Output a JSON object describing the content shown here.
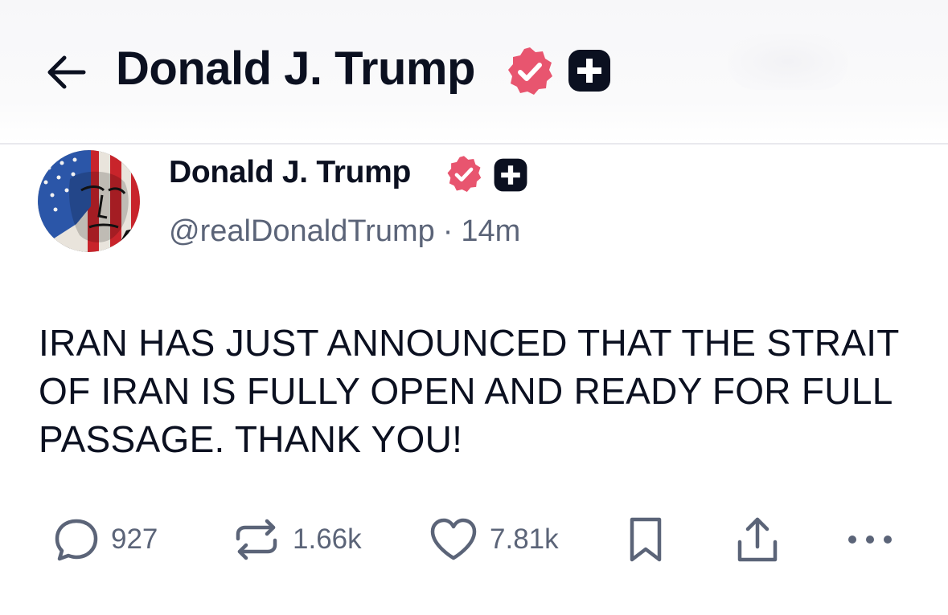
{
  "header": {
    "title": "Donald J. Trump",
    "back_icon": "arrow-left-icon",
    "verified_icon": "verified-badge-icon",
    "plus_icon": "plus-badge-icon"
  },
  "post": {
    "author_name": "Donald J. Trump",
    "handle": "@realDonaldTrump",
    "separator": "·",
    "time": "14m",
    "text": "IRAN HAS JUST ANNOUNCED THAT THE STRAIT OF IRAN IS FULLY OPEN AND READY FOR FULL PASSAGE. THANK YOU!"
  },
  "actions": {
    "reply_count": "927",
    "repost_count": "1.66k",
    "like_count": "7.81k"
  },
  "colors": {
    "verified_badge": "#e8556f",
    "plus_badge": "#0b1020",
    "text_primary": "#0b1020",
    "text_secondary": "#5b6478"
  }
}
